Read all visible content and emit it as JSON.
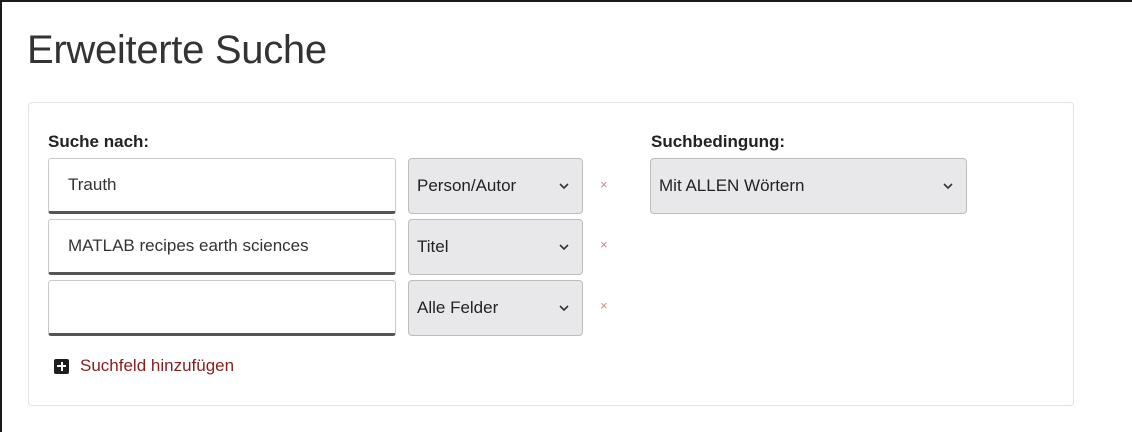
{
  "page": {
    "title": "Erweiterte Suche"
  },
  "search": {
    "search_for_label": "Suche nach:",
    "condition_label": "Suchbedingung:",
    "rows": [
      {
        "value": "Trauth",
        "field": "Person/Autor",
        "remove": "×"
      },
      {
        "value": "MATLAB recipes earth sciences",
        "field": "Titel",
        "remove": "×"
      },
      {
        "value": "",
        "field": "Alle Felder",
        "remove": "×"
      }
    ],
    "condition": "Mit ALLEN Wörtern",
    "add_field_label": "Suchfeld hinzufügen"
  },
  "colors": {
    "link": "#8b1d1d",
    "remove": "#d08a8a",
    "select_bg": "#e8e8ea"
  },
  "icons": {
    "chevron": "chevron-down-icon",
    "add": "plus-square-icon",
    "remove": "close-icon"
  }
}
